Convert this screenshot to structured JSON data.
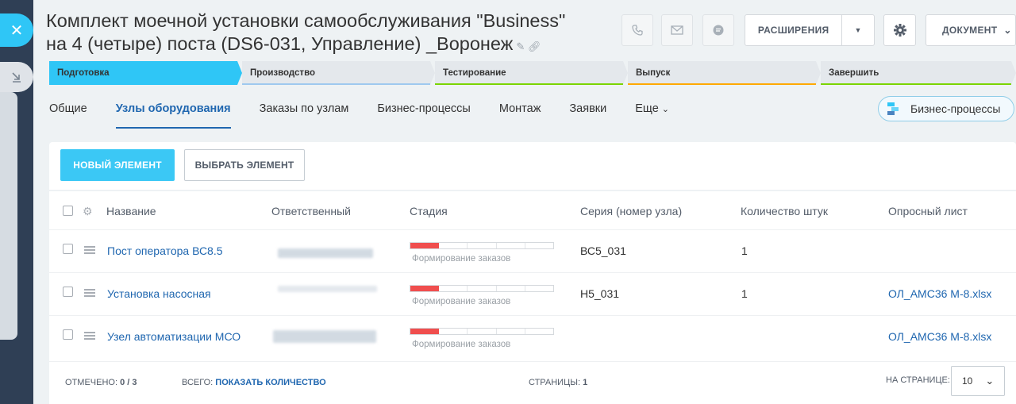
{
  "window": {
    "title_line1": "Комплект моечной установки самообслуживания \"Business\"",
    "title_line2": "на 4 (четыре) поста (DS6-031, Управление) _Воронеж",
    "header_buttons": {
      "extensions": "РАСШИРЕНИЯ",
      "document": "ДОКУМЕНТ"
    }
  },
  "stages": [
    {
      "label": "Подготовка",
      "bg": "#2fc6f6",
      "bar": "#2fc6f6",
      "active": true
    },
    {
      "label": "Производство",
      "bg": "#e4e8ec",
      "bar": "#9ec9ef"
    },
    {
      "label": "Тестирование",
      "bg": "#e4e8ec",
      "bar": "#7bd500"
    },
    {
      "label": "Выпуск",
      "bg": "#e4e8ec",
      "bar": "#ffa900"
    },
    {
      "label": "Завершить",
      "bg": "#e4e8ec",
      "bar": "#7bd500"
    }
  ],
  "tabs": [
    {
      "label": "Общие"
    },
    {
      "label": "Узлы оборудования",
      "active": true
    },
    {
      "label": "Заказы по узлам"
    },
    {
      "label": "Бизнес-процессы"
    },
    {
      "label": "Монтаж"
    },
    {
      "label": "Заявки"
    },
    {
      "label": "Еще"
    }
  ],
  "bp_button": "Бизнес-процессы",
  "toolbar": {
    "new_element": "НОВЫЙ ЭЛЕМЕНТ",
    "choose_element": "ВЫБРАТЬ ЭЛЕМЕНТ"
  },
  "grid": {
    "columns": [
      "Название",
      "Ответственный",
      "Стадия",
      "Серия (номер узла)",
      "Количество штук",
      "Опросный лист"
    ],
    "rows": [
      {
        "name": "Пост оператора ВС8.5",
        "stage": "Формирование заказов",
        "stage_filled_segments": 1,
        "stage_total_segments": 5,
        "series": "ВС5_031",
        "qty": "1",
        "sheet": ""
      },
      {
        "name": "Установка насосная",
        "stage": "Формирование заказов",
        "stage_filled_segments": 1,
        "stage_total_segments": 5,
        "series": "Н5_031",
        "qty": "1",
        "sheet": "ОЛ_АМС36 М-8.xlsx"
      },
      {
        "name": "Узел автоматизации МСО",
        "stage": "Формирование заказов",
        "stage_filled_segments": 1,
        "stage_total_segments": 5,
        "series": "",
        "qty": "",
        "sheet": "ОЛ_АМС36 М-8.xlsx"
      }
    ]
  },
  "footer": {
    "selected_label": "ОТМЕЧЕНО:",
    "selected_value": "0 / 3",
    "total_label": "ВСЕГО:",
    "total_link": "ПОКАЗАТЬ КОЛИЧЕСТВО",
    "pages_label": "СТРАНИЦЫ:",
    "pages_value": "1",
    "per_page_label": "НА СТРАНИЦЕ:",
    "per_page_value": "10"
  },
  "colors": {
    "accent": "#2fc6f6",
    "link": "#2067b0",
    "stage_fill": "#f04e4e"
  }
}
